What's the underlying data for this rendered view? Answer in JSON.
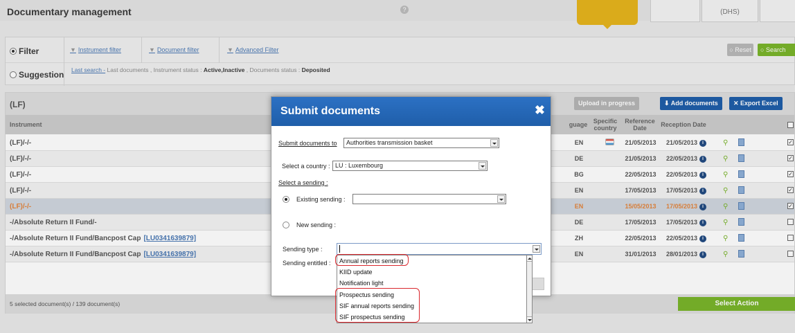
{
  "header": {
    "title": "Documentary management",
    "help": "?",
    "tabs": [
      "(DHS)"
    ]
  },
  "filter": {
    "filter_label": "Filter",
    "suggestion_label": "Suggestion",
    "links": [
      "Instrument filter",
      "Document filter",
      "Advanced Filter"
    ],
    "reset": "Reset",
    "search": "Search",
    "suggestion_text": {
      "link": "Last search -",
      "part1": " Last documents , Instrument status : ",
      "bold1": "Active,Inactive",
      "part2": " , Documents status : ",
      "bold2": "Deposited"
    }
  },
  "grid": {
    "title": "(LF)",
    "buttons": {
      "upload": "Upload in progress",
      "add": "Add documents",
      "export": "Export Excel"
    },
    "columns": {
      "instrument": "Instrument",
      "language": "guage",
      "specific_country": "Specific country",
      "reference_date": "Reference Date",
      "reception_date": "Reception Date"
    },
    "rows": [
      {
        "instrument": "(LF)/-/-",
        "isin": "",
        "lang": "EN",
        "ref": "21/05/2013",
        "rec": "21/05/2013",
        "checked": true,
        "flag": true
      },
      {
        "instrument": "(LF)/-/-",
        "isin": "",
        "lang": "DE",
        "ref": "21/05/2013",
        "rec": "22/05/2013",
        "checked": true,
        "flag": false
      },
      {
        "instrument": "(LF)/-/-",
        "isin": "",
        "lang": "BG",
        "ref": "22/05/2013",
        "rec": "22/05/2013",
        "checked": true,
        "flag": false
      },
      {
        "instrument": "(LF)/-/-",
        "isin": "",
        "lang": "EN",
        "ref": "17/05/2013",
        "rec": "17/05/2013",
        "checked": true,
        "flag": false
      },
      {
        "instrument": "(LF)/-/-",
        "isin": "",
        "lang": "EN",
        "ref": "15/05/2013",
        "rec": "17/05/2013",
        "checked": true,
        "flag": false,
        "highlight": true
      },
      {
        "instrument": "-/Absolute Return II Fund/-",
        "isin": "",
        "lang": "DE",
        "ref": "17/05/2013",
        "rec": "17/05/2013",
        "checked": false,
        "flag": false
      },
      {
        "instrument": "-/Absolute Return II Fund/Bancpost Cap",
        "isin": "[LU0341639879]",
        "lang": "ZH",
        "ref": "22/05/2013",
        "rec": "22/05/2013",
        "checked": false,
        "flag": false
      },
      {
        "instrument": "-/Absolute Return II Fund/Bancpost Cap",
        "isin": "[LU0341639879]",
        "lang": "EN",
        "ref": "31/01/2013",
        "rec": "28/01/2013",
        "checked": false,
        "flag": false
      }
    ],
    "footer": "5 selected document(s) / 139 document(s)",
    "select_action": "Select Action"
  },
  "modal": {
    "title": "Submit documents",
    "close": "✖",
    "submit_to_label": "Submit documents to",
    "submit_to_value": "Authorities transmission basket",
    "country_label": "Select a country :",
    "country_value": "LU  : Luxembourg",
    "sending_label": "Select a sending :",
    "existing_label": "Existing sending :",
    "new_label": "New sending :",
    "type_label": "Sending type :",
    "entitled_label": "Sending entitled :",
    "options": [
      "Annual reports sending",
      "KIID update",
      "Notification light",
      "Prospectus sending",
      "SIF annual reports sending",
      "SIF prospectus sending"
    ]
  },
  "colors": {
    "accent_blue": "#1f5ea9",
    "green": "#7ab52b",
    "yellow": "#e6b51d",
    "annotation_red": "#d9262c"
  }
}
